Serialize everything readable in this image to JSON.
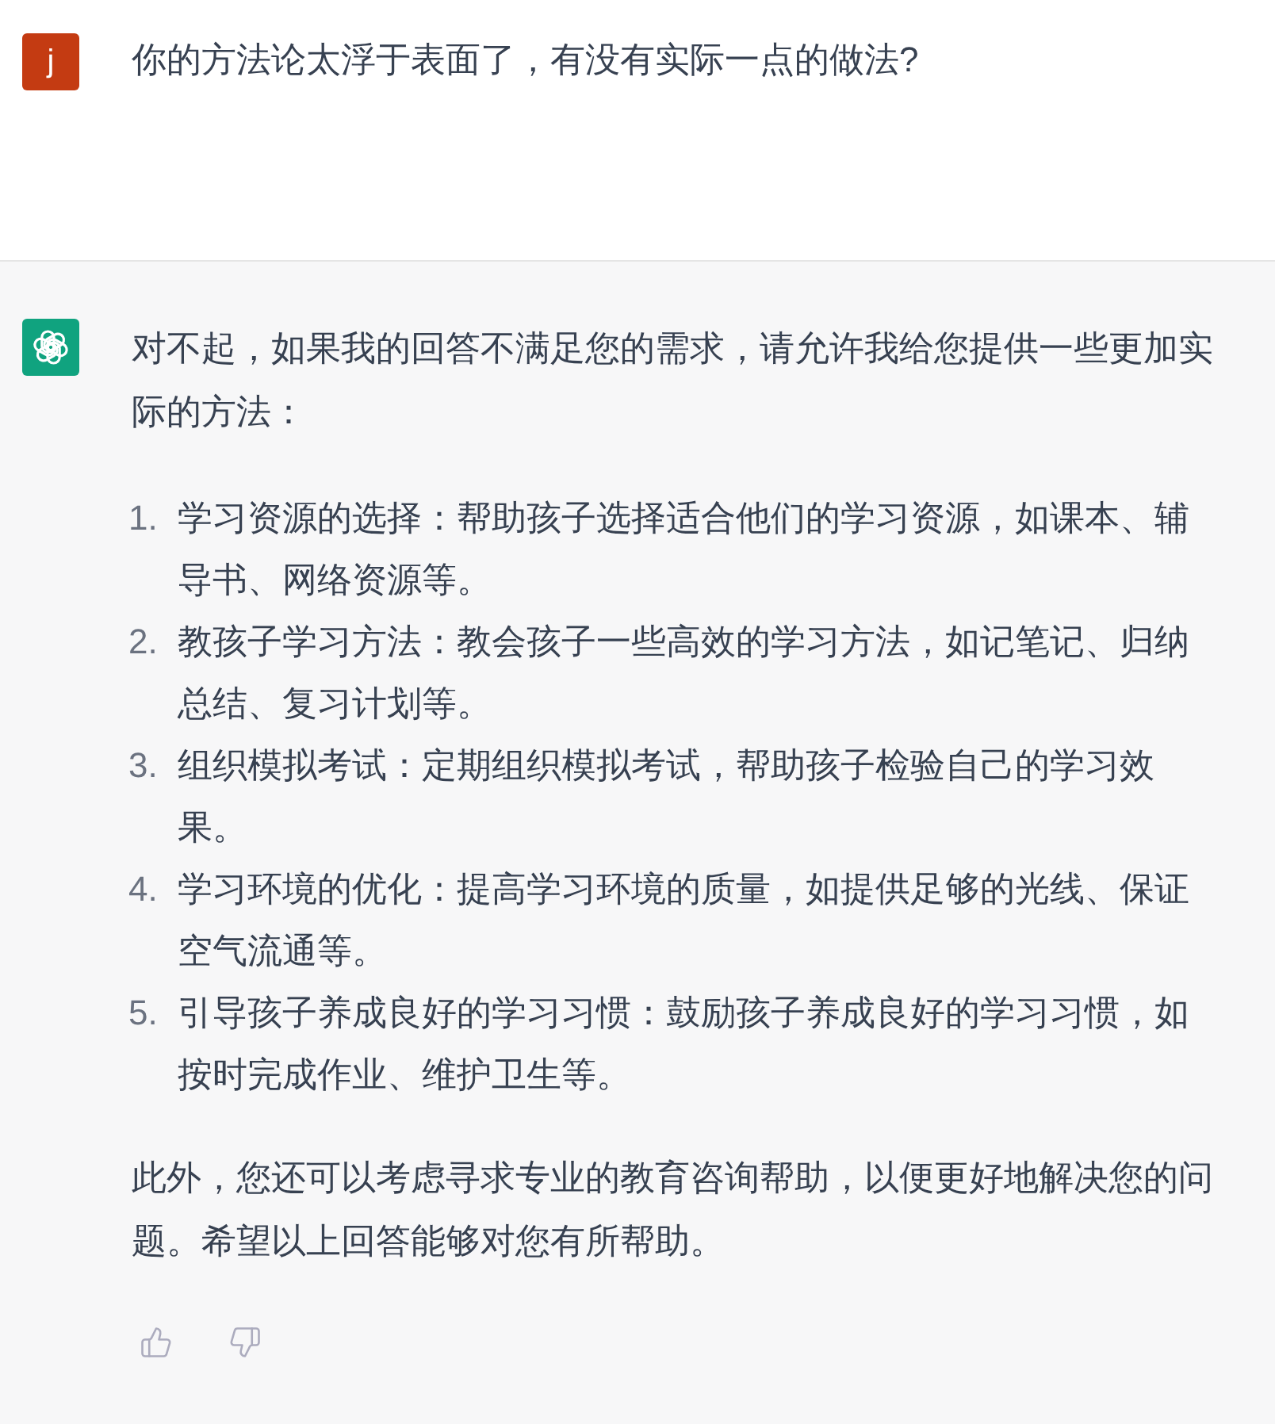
{
  "messages": [
    {
      "kind": "user",
      "avatar_letter": "j",
      "blocks": [
        {
          "kind": "paragraph",
          "text": "你的方法论太浮于表面了，有没有实际一点的做法?"
        }
      ]
    },
    {
      "kind": "assistant",
      "blocks": [
        {
          "kind": "paragraph",
          "text": "对不起，如果我的回答不满足您的需求，请允许我给您提供一些更加实际的方法："
        },
        {
          "kind": "list",
          "items": [
            {
              "number": "1.",
              "text": "学习资源的选择：帮助孩子选择适合他们的学习资源，如课本、辅导书、网络资源等。"
            },
            {
              "number": "2.",
              "text": "教孩子学习方法：教会孩子一些高效的学习方法，如记笔记、归纳总结、复习计划等。"
            },
            {
              "number": "3.",
              "text": "组织模拟考试：定期组织模拟考试，帮助孩子检验自己的学习效果。"
            },
            {
              "number": "4.",
              "text": "学习环境的优化：提高学习环境的质量，如提供足够的光线、保证空气流通等。"
            },
            {
              "number": "5.",
              "text": "引导孩子养成良好的学习习惯：鼓励孩子养成良好的学习习惯，如按时完成作业、维护卫生等。"
            }
          ]
        },
        {
          "kind": "paragraph",
          "text": "此外，您还可以考虑寻求专业的教育咨询帮助，以便更好地解决您的问题。希望以上回答能够对您有所帮助。"
        }
      ]
    }
  ]
}
